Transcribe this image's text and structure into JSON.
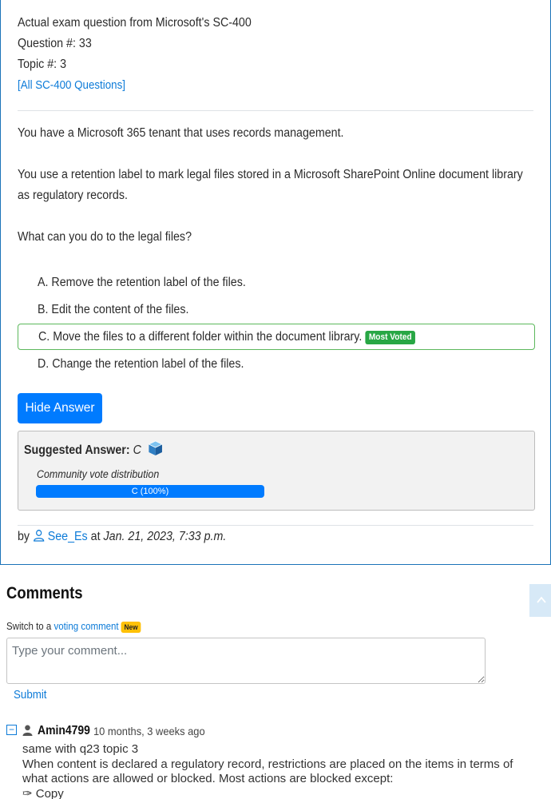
{
  "question": {
    "source_line": "Actual exam question from Microsoft's SC-400",
    "number_line": "Question #: 33",
    "topic_line": "Topic #: 3",
    "all_questions_link": "[All SC-400 Questions]",
    "paragraphs": [
      "You have a Microsoft 365 tenant that uses records management.",
      "You use a retention label to mark legal files stored in a Microsoft SharePoint Online document library as regulatory records.",
      "What can you do to the legal files?"
    ],
    "choices": [
      {
        "text": "A. Remove the retention label of the files."
      },
      {
        "text": "B. Edit the content of the files."
      },
      {
        "text": "C. Move the files to a different folder within the document library.",
        "badge": "Most Voted"
      },
      {
        "text": "D. Change the retention label of the files."
      }
    ],
    "hide_answer_label": "Hide Answer",
    "suggested_answer_label": "Suggested Answer:",
    "suggested_answer_value": "C",
    "vote_distribution_label": "Community vote distribution",
    "vote_bar_label": "C (100%)",
    "vote_percent": 100,
    "by_label": "by",
    "author": "See_Es",
    "at_label": "at",
    "date": "Jan. 21, 2023, 7:33 p.m."
  },
  "comments": {
    "heading": "Comments",
    "switch_prefix": "Switch to a",
    "switch_link": "voting comment",
    "new_badge": "New",
    "input_placeholder": "Type your comment...",
    "submit_label": "Submit",
    "items": [
      {
        "toggle": "−",
        "user": "Amin4799",
        "time": "10 months, 3 weeks ago",
        "lines": [
          "same with q23 topic 3",
          "When content is declared a regulatory record, restrictions are placed on the items in terms of what actions are allowed or blocked. Most actions are blocked except:",
          "✑ Copy"
        ]
      }
    ]
  },
  "colors": {
    "accent": "#007bff",
    "link": "#0d7bd8",
    "most_voted": "#28a745",
    "new_badge": "#ffc107",
    "card_border": "#1a73b8"
  },
  "icons": {
    "cube": "cube-icon",
    "user_outline": "user-outline-icon",
    "user_solid": "user-solid-icon",
    "scroll_top": "chevron-up-icon",
    "collapse": "collapse-minus-icon"
  }
}
